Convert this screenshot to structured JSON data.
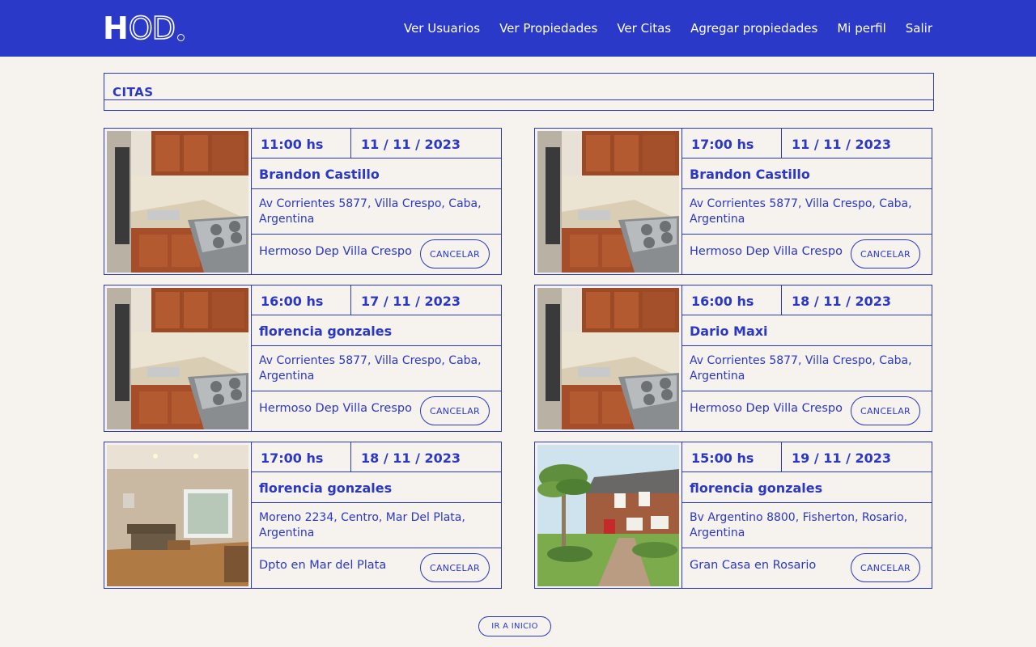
{
  "header": {
    "logo_bold": "H",
    "logo_outline": "OD",
    "nav": [
      {
        "label": "Ver Usuarios"
      },
      {
        "label": "Ver Propiedades"
      },
      {
        "label": "Ver Citas"
      },
      {
        "label": "Agregar propiedades"
      },
      {
        "label": "Mi perfil"
      },
      {
        "label": "Salir"
      }
    ]
  },
  "section": {
    "title": "CITAS"
  },
  "appointments": [
    {
      "time": "11:00 hs",
      "date": "11 / 11 / 2023",
      "name": "Brandon Castillo",
      "address": "Av Corrientes 5877, Villa Crespo, Caba, Argentina",
      "property": "Hermoso Dep Villa Crespo",
      "cancel": "CANCELAR",
      "image": "kitchen-photo"
    },
    {
      "time": "17:00 hs",
      "date": "11 / 11 / 2023",
      "name": "Brandon Castillo",
      "address": "Av Corrientes 5877, Villa Crespo, Caba, Argentina",
      "property": "Hermoso Dep Villa Crespo",
      "cancel": "CANCELAR",
      "image": "kitchen-photo"
    },
    {
      "time": "16:00 hs",
      "date": "17 / 11 / 2023",
      "name": "florencia gonzales",
      "address": "Av Corrientes 5877, Villa Crespo, Caba, Argentina",
      "property": "Hermoso Dep Villa Crespo",
      "cancel": "CANCELAR",
      "image": "kitchen-photo"
    },
    {
      "time": "16:00 hs",
      "date": "18 / 11 / 2023",
      "name": "Dario Maxi",
      "address": "Av Corrientes 5877, Villa Crespo, Caba, Argentina",
      "property": "Hermoso Dep Villa Crespo",
      "cancel": "CANCELAR",
      "image": "kitchen-photo"
    },
    {
      "time": "17:00 hs",
      "date": "18 / 11 / 2023",
      "name": "florencia gonzales",
      "address": "Moreno 2234, Centro, Mar Del Plata, Argentina",
      "property": "Dpto en Mar del Plata",
      "cancel": "CANCELAR",
      "image": "living-room-photo"
    },
    {
      "time": "15:00 hs",
      "date": "19 / 11 / 2023",
      "name": "florencia gonzales",
      "address": "Bv Argentino 8800, Fisherton, Rosario, Argentina",
      "property": "Gran Casa en Rosario",
      "cancel": "CANCELAR",
      "image": "house-photo"
    }
  ],
  "footer": {
    "home_button": "IR A INICIO"
  },
  "colors": {
    "primary": "#2a39c8",
    "background": "#f6f2ee",
    "text": "#2b38c6"
  }
}
